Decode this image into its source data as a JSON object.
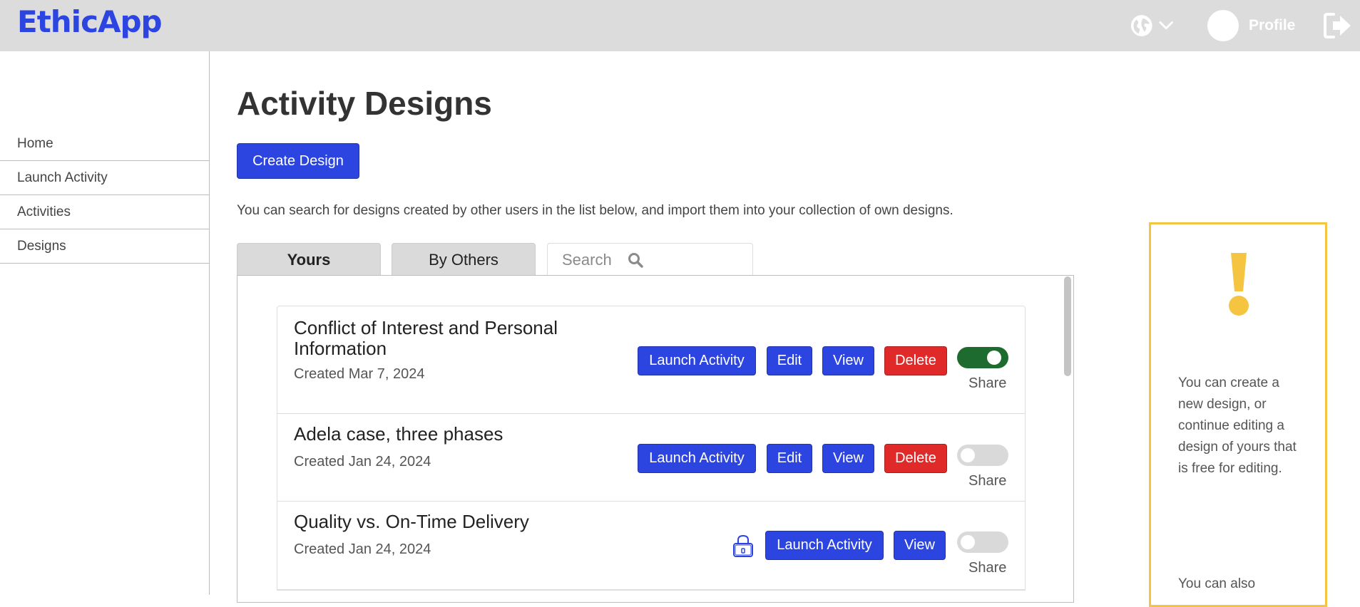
{
  "header": {
    "brand": "EthicApp",
    "profile_label": "Profile",
    "icons": [
      "globe-icon",
      "chevron-down-icon",
      "logout-icon"
    ]
  },
  "sidebar": {
    "items": [
      {
        "label": "Home"
      },
      {
        "label": "Launch Activity"
      },
      {
        "label": "Activities"
      },
      {
        "label": "Designs"
      }
    ]
  },
  "main": {
    "title": "Activity Designs",
    "create_button": "Create Design",
    "help_text": "You can search for designs created by other users in the list below, and import them into your collection of own designs.",
    "tabs": [
      {
        "label": "Yours",
        "active": true
      },
      {
        "label": "By Others",
        "active": false
      }
    ],
    "search": {
      "placeholder": "Search",
      "value": ""
    }
  },
  "designs": [
    {
      "title": "Conflict of Interest and Personal Information",
      "created": "Created Mar 7, 2024",
      "actions": {
        "launch": "Launch Activity",
        "edit": "Edit",
        "view": "View",
        "delete": "Delete"
      },
      "shared": true,
      "locked": false,
      "share_label": "Share"
    },
    {
      "title": "Adela case, three phases",
      "created": "Created Jan 24, 2024",
      "actions": {
        "launch": "Launch Activity",
        "edit": "Edit",
        "view": "View",
        "delete": "Delete"
      },
      "shared": false,
      "locked": false,
      "share_label": "Share"
    },
    {
      "title": "Quality vs. On-Time Delivery",
      "created": "Created Jan 24, 2024",
      "actions": {
        "launch": "Launch Activity",
        "view": "View"
      },
      "shared": false,
      "locked": true,
      "share_label": "Share"
    }
  ],
  "notice": {
    "text": "You can create a new design, or continue editing a design of yours that is free for editing.",
    "text2": "You can also"
  },
  "colors": {
    "brand": "#2c45e0",
    "danger": "#e02a2a",
    "toggle_on": "#1d6b2e",
    "notice_border": "#f5c542"
  }
}
